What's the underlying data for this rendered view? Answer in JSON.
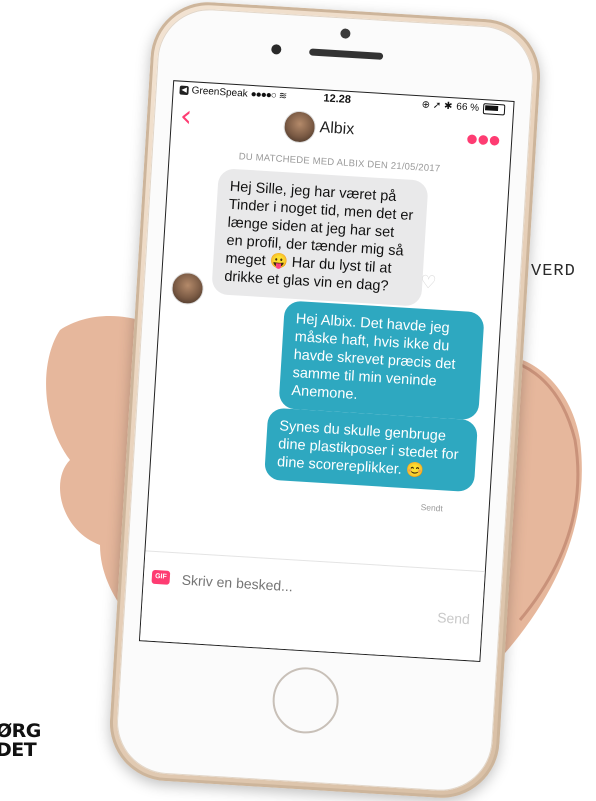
{
  "side_text": "VERD",
  "logo": {
    "line1": "ØRG",
    "line2": "DET"
  },
  "status_bar": {
    "carrier": "GreenSpeak",
    "signal": "●●●●○",
    "time": "12.28",
    "icons": "⊕ ➚ ✱",
    "battery": "66 %"
  },
  "nav": {
    "back_icon": "chevron-left-icon",
    "contact_name": "Albix",
    "more_icon": "ellipsis-icon",
    "accent_color": "#fe3c72"
  },
  "match_notice": "DU MATCHEDE MED ALBIX DEN 21/05/2017",
  "messages": [
    {
      "from": "Albix",
      "direction": "incoming",
      "text": "Hej Sille, jeg har været på Tinder i noget tid, men det er længe siden at jeg har set en profil, der tænder mig så meget 😛 Har du lyst til at drikke et glas vin en dag?"
    },
    {
      "from": "me",
      "direction": "outgoing",
      "text": "Hej Albix. Det havde jeg måske haft, hvis ikke du havde skrevet præcis det samme til min veninde Anemone."
    },
    {
      "from": "me",
      "direction": "outgoing",
      "text": "Synes du skulle genbruge dine plastikposer i stedet for dine scorereplikker. 😊"
    }
  ],
  "sent_label": "Sendt",
  "composer": {
    "gif_label": "GIF",
    "placeholder": "Skriv en besked...",
    "send_label": "Send"
  },
  "colors": {
    "outgoing_bubble": "#2ea8c0",
    "incoming_bubble": "#e9e9ea"
  }
}
